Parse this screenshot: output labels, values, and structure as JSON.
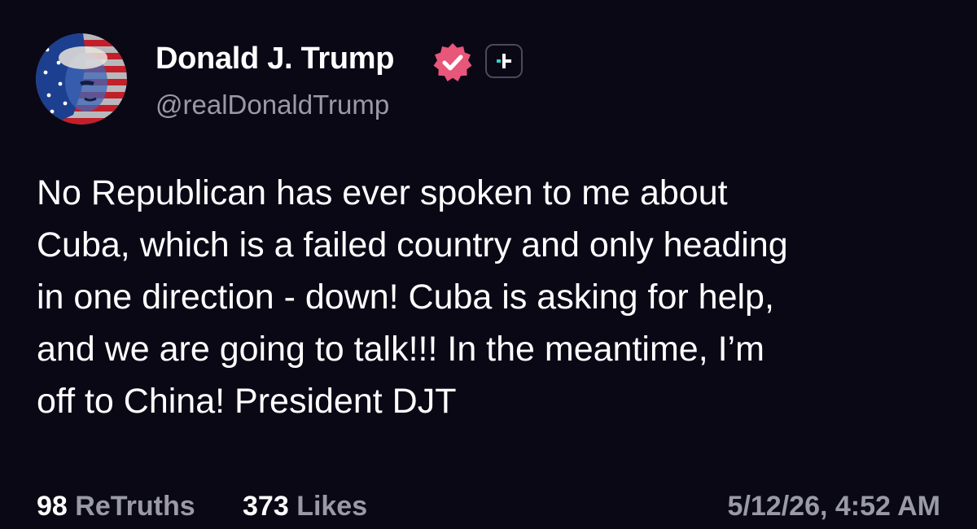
{
  "author": {
    "display_name": "Donald J. Trump",
    "handle": "@realDonaldTrump",
    "verified": true,
    "verified_badge_color": "#e8567a",
    "plus_badge_color": "#2fd3c0"
  },
  "post": {
    "lines": [
      "No Republican has ever spoken to me about",
      "Cuba, which is a failed country and only heading",
      "in one direction - down! Cuba is asking for help,",
      "and we are going to talk!!! In the meantime, I’m",
      "off to China! President DJT"
    ]
  },
  "stats": {
    "retruths_count": "98",
    "retruths_label": "ReTruths",
    "likes_count": "373",
    "likes_label": "Likes"
  },
  "timestamp": "5/12/26, 4:52 AM",
  "colors": {
    "background": "#0b0816",
    "text_primary": "#ffffff",
    "text_secondary": "#9a9aa6"
  }
}
